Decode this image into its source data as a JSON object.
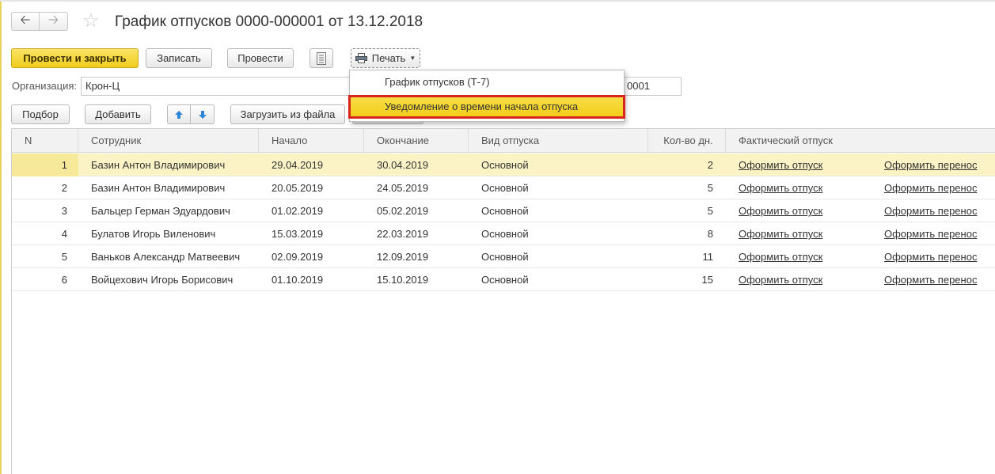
{
  "window": {
    "title": "График отпусков 0000-000001 от 13.12.2018"
  },
  "toolbar": {
    "post_close": "Провести и закрыть",
    "save": "Записать",
    "post": "Провести",
    "print": "Печать"
  },
  "form": {
    "org_label": "Организация:",
    "org_value": "Крон-Ц",
    "number_value": "0001"
  },
  "table_toolbar": {
    "select": "Подбор",
    "add": "Добавить",
    "load_file": "Загрузить из файла"
  },
  "print_menu": {
    "items": [
      {
        "label": "График отпусков (Т-7)"
      },
      {
        "label": "Уведомление о времени начала отпуска"
      }
    ]
  },
  "table": {
    "columns": [
      "N",
      "Сотрудник",
      "Начало",
      "Окончание",
      "Вид отпуска",
      "Кол-во дн.",
      "Фактический отпуск"
    ],
    "rows": [
      {
        "n": "1",
        "employee": "Базин Антон Владимирович",
        "start": "29.04.2019",
        "end": "30.04.2019",
        "type": "Основной",
        "days": "2",
        "actual": "Оформить отпуск",
        "transfer": "Оформить перенос"
      },
      {
        "n": "2",
        "employee": "Базин Антон Владимирович",
        "start": "20.05.2019",
        "end": "24.05.2019",
        "type": "Основной",
        "days": "5",
        "actual": "Оформить отпуск",
        "transfer": "Оформить перенос"
      },
      {
        "n": "3",
        "employee": "Бальцер Герман Эдуардович",
        "start": "01.02.2019",
        "end": "05.02.2019",
        "type": "Основной",
        "days": "5",
        "actual": "Оформить отпуск",
        "transfer": "Оформить перенос"
      },
      {
        "n": "4",
        "employee": "Булатов Игорь Виленович",
        "start": "15.03.2019",
        "end": "22.03.2019",
        "type": "Основной",
        "days": "8",
        "actual": "Оформить отпуск",
        "transfer": "Оформить перенос"
      },
      {
        "n": "5",
        "employee": "Ваньков Александр Матвеевич",
        "start": "02.09.2019",
        "end": "12.09.2019",
        "type": "Основной",
        "days": "11",
        "actual": "Оформить отпуск",
        "transfer": "Оформить перенос"
      },
      {
        "n": "6",
        "employee": "Войцехович Игорь Борисович",
        "start": "01.10.2019",
        "end": "15.10.2019",
        "type": "Основной",
        "days": "15",
        "actual": "Оформить отпуск",
        "transfer": "Оформить перенос"
      }
    ]
  },
  "colors": {
    "accent": "#f2cd19",
    "selected_row": "#fbf3c6",
    "highlight_border": "#d8261f"
  }
}
